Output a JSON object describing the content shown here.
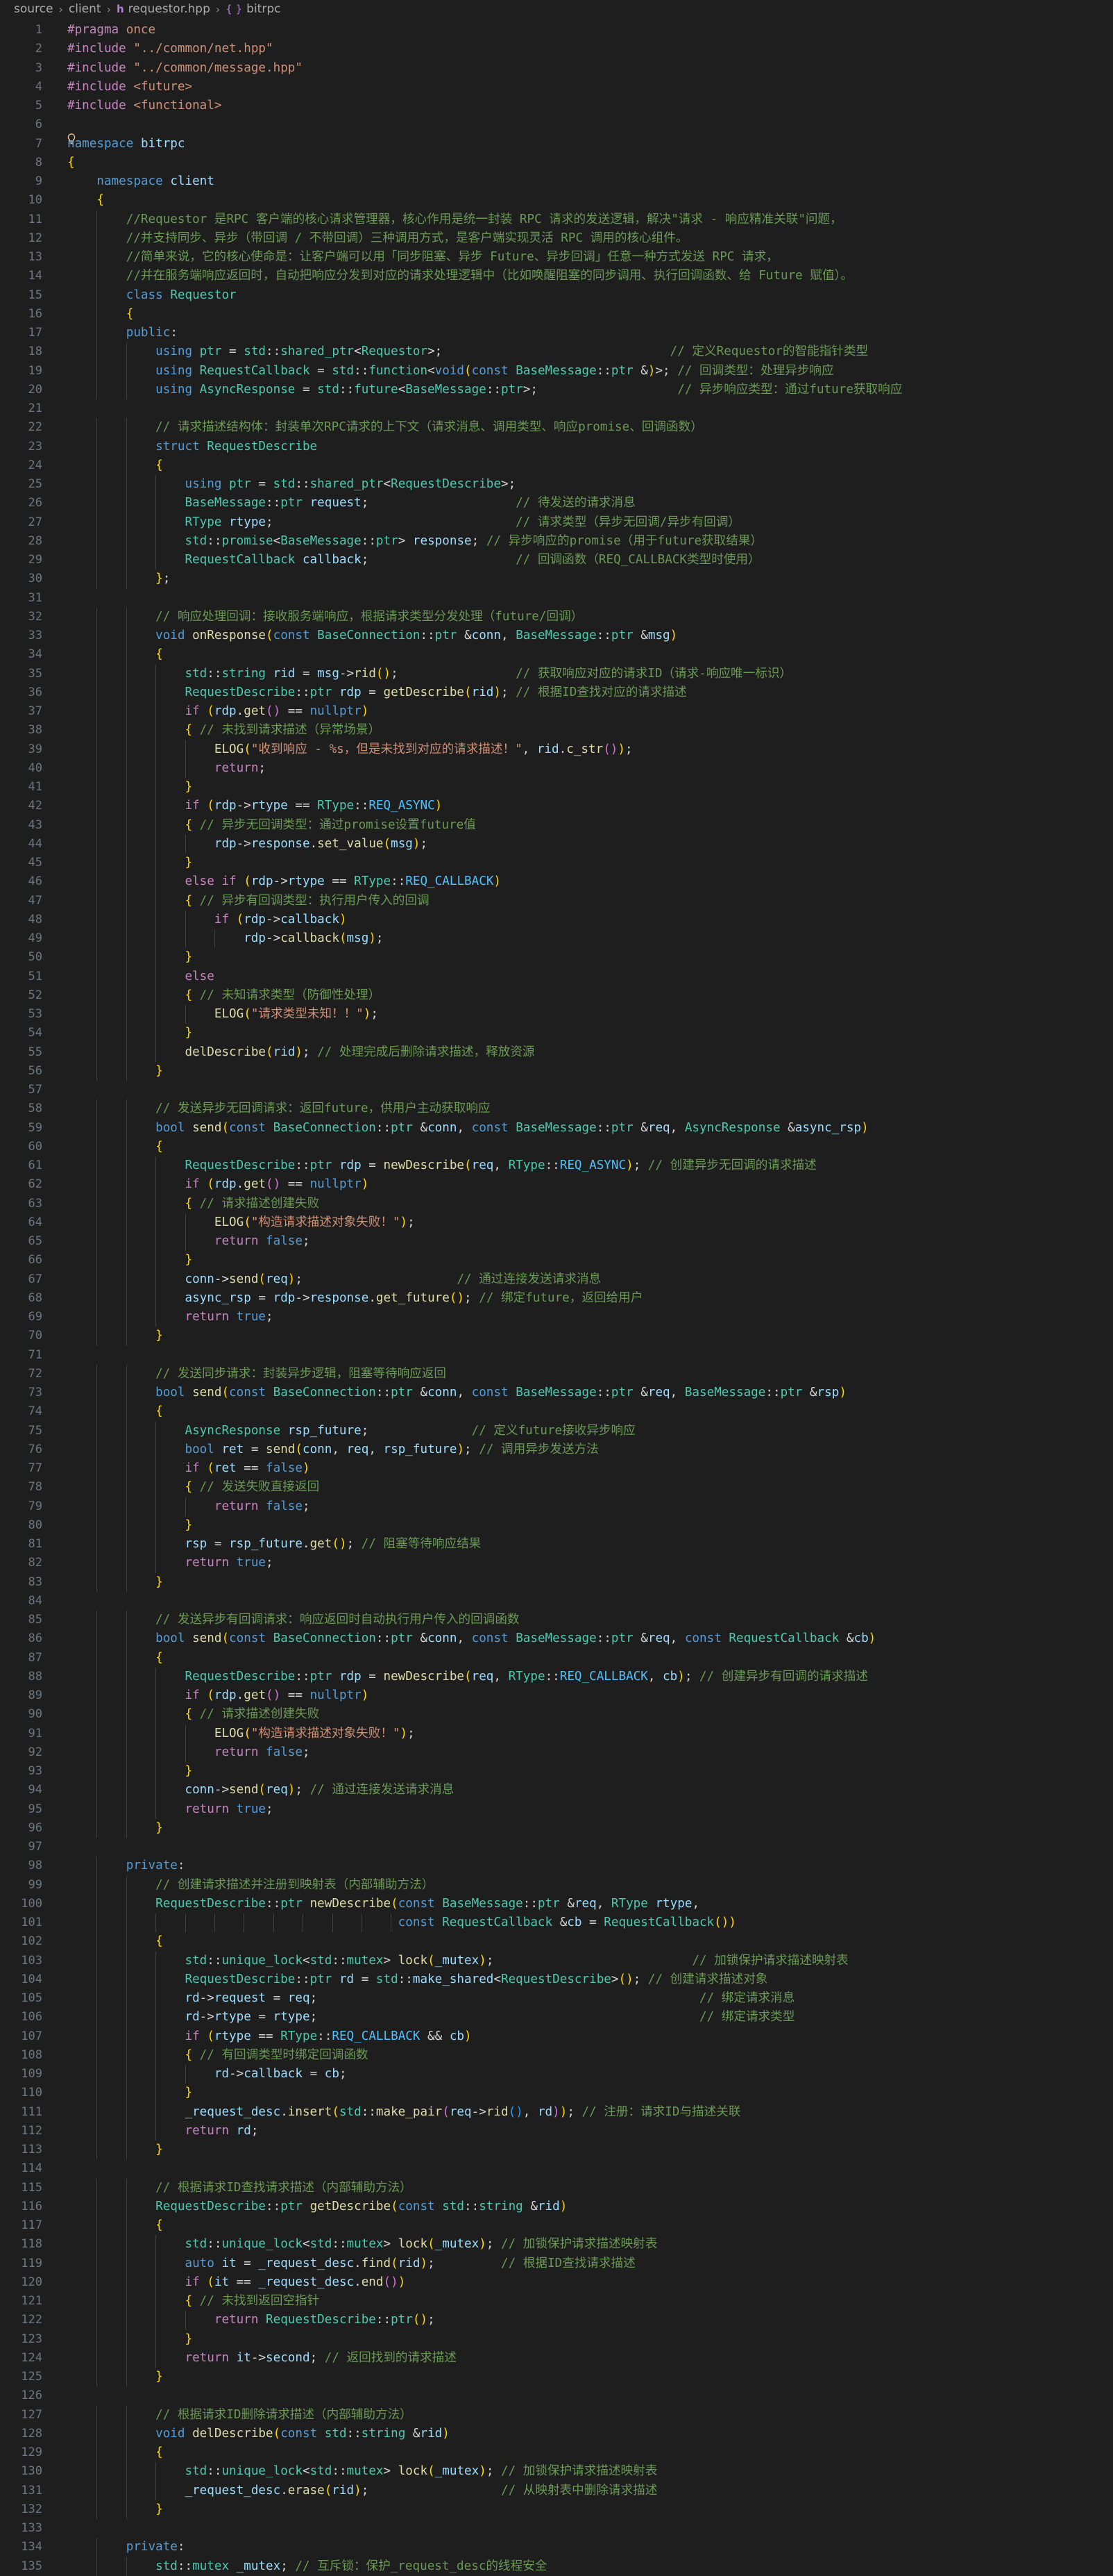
{
  "breadcrumb": {
    "items": [
      "source",
      "client",
      "requestor.hpp",
      "bitrpc"
    ]
  },
  "editor": {
    "line_start": 1,
    "lines": [
      "#pragma once",
      "#include \"../common/net.hpp\"",
      "#include \"../common/message.hpp\"",
      "#include <future>",
      "#include <functional>",
      "",
      "namespace bitrpc",
      "{",
      "    namespace client",
      "    {",
      "        //Requestor 是RPC 客户端的核心请求管理器，核心作用是统一封装 RPC 请求的发送逻辑，解决\"请求 - 响应精准关联\"问题，",
      "        //并支持同步、异步（带回调 / 不带回调）三种调用方式，是客户端实现灵活 RPC 调用的核心组件。",
      "        //简单来说，它的核心使命是：让客户端可以用「同步阻塞、异步 Future、异步回调」任意一种方式发送 RPC 请求，",
      "        //并在服务端响应返回时，自动把响应分发到对应的请求处理逻辑中（比如唤醒阻塞的同步调用、执行回调函数、给 Future 赋值）。",
      "        class Requestor",
      "        {",
      "        public:",
      "            using ptr = std::shared_ptr<Requestor>;                               // 定义Requestor的智能指针类型",
      "            using RequestCallback = std::function<void(const BaseMessage::ptr &)>; // 回调类型：处理异步响应",
      "            using AsyncResponse = std::future<BaseMessage::ptr>;                   // 异步响应类型：通过future获取响应",
      "",
      "            // 请求描述结构体：封装单次RPC请求的上下文（请求消息、调用类型、响应promise、回调函数）",
      "            struct RequestDescribe",
      "            {",
      "                using ptr = std::shared_ptr<RequestDescribe>;",
      "                BaseMessage::ptr request;                    // 待发送的请求消息",
      "                RType rtype;                                 // 请求类型（异步无回调/异步有回调）",
      "                std::promise<BaseMessage::ptr> response; // 异步响应的promise（用于future获取结果）",
      "                RequestCallback callback;                    // 回调函数（REQ_CALLBACK类型时使用）",
      "            };",
      "",
      "            // 响应处理回调：接收服务端响应，根据请求类型分发处理（future/回调）",
      "            void onResponse(const BaseConnection::ptr &conn, BaseMessage::ptr &msg)",
      "            {",
      "                std::string rid = msg->rid();                // 获取响应对应的请求ID（请求-响应唯一标识）",
      "                RequestDescribe::ptr rdp = getDescribe(rid); // 根据ID查找对应的请求描述",
      "                if (rdp.get() == nullptr)",
      "                { // 未找到请求描述（异常场景）",
      "                    ELOG(\"收到响应 - %s，但是未找到对应的请求描述！\", rid.c_str());",
      "                    return;",
      "                }",
      "                if (rdp->rtype == RType::REQ_ASYNC)",
      "                { // 异步无回调类型：通过promise设置future值",
      "                    rdp->response.set_value(msg);",
      "                }",
      "                else if (rdp->rtype == RType::REQ_CALLBACK)",
      "                { // 异步有回调类型：执行用户传入的回调",
      "                    if (rdp->callback)",
      "                        rdp->callback(msg);",
      "                }",
      "                else",
      "                { // 未知请求类型（防御性处理）",
      "                    ELOG(\"请求类型未知！！\");",
      "                }",
      "                delDescribe(rid); // 处理完成后删除请求描述，释放资源",
      "            }",
      "",
      "            // 发送异步无回调请求：返回future，供用户主动获取响应",
      "            bool send(const BaseConnection::ptr &conn, const BaseMessage::ptr &req, AsyncResponse &async_rsp)",
      "            {",
      "                RequestDescribe::ptr rdp = newDescribe(req, RType::REQ_ASYNC); // 创建异步无回调的请求描述",
      "                if (rdp.get() == nullptr)",
      "                { // 请求描述创建失败",
      "                    ELOG(\"构造请求描述对象失败！\");",
      "                    return false;",
      "                }",
      "                conn->send(req);                     // 通过连接发送请求消息",
      "                async_rsp = rdp->response.get_future(); // 绑定future，返回给用户",
      "                return true;",
      "            }",
      "",
      "            // 发送同步请求：封装异步逻辑，阻塞等待响应返回",
      "            bool send(const BaseConnection::ptr &conn, const BaseMessage::ptr &req, BaseMessage::ptr &rsp)",
      "            {",
      "                AsyncResponse rsp_future;              // 定义future接收异步响应",
      "                bool ret = send(conn, req, rsp_future); // 调用异步发送方法",
      "                if (ret == false)",
      "                { // 发送失败直接返回",
      "                    return false;",
      "                }",
      "                rsp = rsp_future.get(); // 阻塞等待响应结果",
      "                return true;",
      "            }",
      "",
      "            // 发送异步有回调请求：响应返回时自动执行用户传入的回调函数",
      "            bool send(const BaseConnection::ptr &conn, const BaseMessage::ptr &req, const RequestCallback &cb)",
      "            {",
      "                RequestDescribe::ptr rdp = newDescribe(req, RType::REQ_CALLBACK, cb); // 创建异步有回调的请求描述",
      "                if (rdp.get() == nullptr)",
      "                { // 请求描述创建失败",
      "                    ELOG(\"构造请求描述对象失败！\");",
      "                    return false;",
      "                }",
      "                conn->send(req); // 通过连接发送请求消息",
      "                return true;",
      "            }",
      "",
      "        private:",
      "            // 创建请求描述并注册到映射表（内部辅助方法）",
      "            RequestDescribe::ptr newDescribe(const BaseMessage::ptr &req, RType rtype,",
      "                                             const RequestCallback &cb = RequestCallback())",
      "            {",
      "                std::unique_lock<std::mutex> lock(_mutex);                           // 加锁保护请求描述映射表",
      "                RequestDescribe::ptr rd = std::make_shared<RequestDescribe>(); // 创建请求描述对象",
      "                rd->request = req;                                                    // 绑定请求消息",
      "                rd->rtype = rtype;                                                    // 绑定请求类型",
      "                if (rtype == RType::REQ_CALLBACK && cb)",
      "                { // 有回调类型时绑定回调函数",
      "                    rd->callback = cb;",
      "                }",
      "                _request_desc.insert(std::make_pair(req->rid(), rd)); // 注册：请求ID与描述关联",
      "                return rd;",
      "            }",
      "",
      "            // 根据请求ID查找请求描述（内部辅助方法）",
      "            RequestDescribe::ptr getDescribe(const std::string &rid)",
      "            {",
      "                std::unique_lock<std::mutex> lock(_mutex); // 加锁保护请求描述映射表",
      "                auto it = _request_desc.find(rid);         // 根据ID查找请求描述",
      "                if (it == _request_desc.end())",
      "                { // 未找到返回空指针",
      "                    return RequestDescribe::ptr();",
      "                }",
      "                return it->second; // 返回找到的请求描述",
      "            }",
      "",
      "            // 根据请求ID删除请求描述（内部辅助方法）",
      "            void delDescribe(const std::string &rid)",
      "            {",
      "                std::unique_lock<std::mutex> lock(_mutex); // 加锁保护请求描述映射表",
      "                _request_desc.erase(rid);                  // 从映射表中删除请求描述",
      "            }",
      "",
      "        private:",
      "            std::mutex _mutex; // 互斥锁：保护_request_desc的线程安全"
    ]
  }
}
